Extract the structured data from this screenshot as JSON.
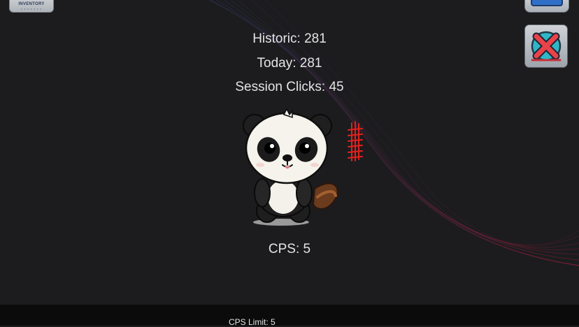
{
  "stats": {
    "historic": "Historic: 281",
    "today": "Today: 281",
    "session_clicks": "Session Clicks: 45",
    "cps": "CPS: 5"
  },
  "inventory_button": {
    "label": "INVENTORY",
    "sub": "• • • • • • •"
  },
  "footer": {
    "cps_limit": "CPS Limit: 5"
  },
  "colors": {
    "background": "#1c1c1e",
    "tally": "#e3201d",
    "close_x": "#e8424a",
    "close_circle": "#31b6c8"
  },
  "icons": {
    "top_right": "window-icon",
    "close": "close-icon",
    "character": "panda-character",
    "tally": "tally-marks"
  }
}
